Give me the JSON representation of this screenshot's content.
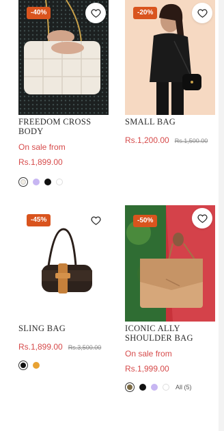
{
  "products": [
    {
      "badge": "-40%",
      "title": "FREEDOM CROSS BODY",
      "sale_text": "On sale from",
      "price": "Rs.1,899.00",
      "compare_price": "",
      "swatches": [
        "#f1ede4",
        "#c7b6f2",
        "#111111",
        "#ffffff"
      ]
    },
    {
      "badge": "-20%",
      "title": "SMALL BAG",
      "sale_text": "",
      "price": "Rs.1,200.00",
      "compare_price": "Rs.1,500.00",
      "swatches": []
    },
    {
      "badge": "-45%",
      "title": "SLING BAG",
      "sale_text": "",
      "price": "Rs.1,899.00",
      "compare_price": "Rs.3,500.00",
      "swatches": [
        "#111111",
        "#e8a233"
      ]
    },
    {
      "badge": "-50%",
      "title": "ICONIC ALLY SHOULDER BAG",
      "sale_text": "On sale from",
      "price": "Rs.1,999.00",
      "compare_price": "",
      "swatches": [
        "#7b6a44",
        "#111111",
        "#c7b6f2",
        "#ffffff"
      ],
      "all_label": "All (5)"
    }
  ],
  "colors": {
    "badge": "#d9541e",
    "price": "#d64a4a"
  },
  "icons": [
    "heart-icon"
  ]
}
